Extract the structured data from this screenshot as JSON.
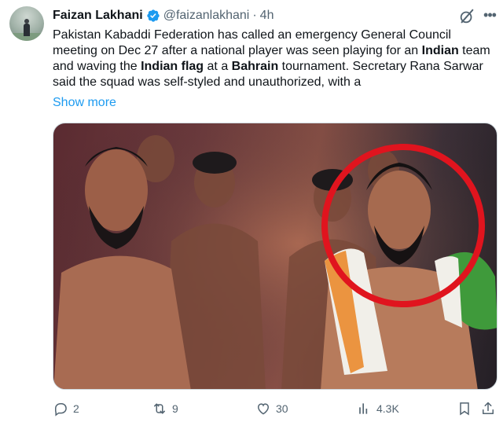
{
  "tweet": {
    "author_name": "Faizan Lakhani",
    "handle": "@faizanlakhani",
    "separator": "·",
    "time": "4h",
    "text": {
      "p1": "Pakistan Kabaddi Federation has called an emergency General Council meeting on Dec 27 after a national player was seen playing for an ",
      "b1": "Indian",
      "p2": " team and waving the ",
      "b2": "Indian flag",
      "p3": " at a ",
      "b3": "Bahrain",
      "p4": " tournament. Secretary Rana Sarwar said the squad was self-styled and unauthorized, with a"
    },
    "show_more_label": "Show more",
    "icons": {
      "verified": "verified-badge-icon",
      "grok": "grok-icon",
      "more": "more-options-icon"
    },
    "colors": {
      "accent": "#1d9bf0",
      "muted": "#536471",
      "text": "#0f1419",
      "highlight_circle": "#e0141e"
    }
  },
  "actions": {
    "replies": "2",
    "reposts": "9",
    "likes": "30",
    "views": "4.3K"
  }
}
